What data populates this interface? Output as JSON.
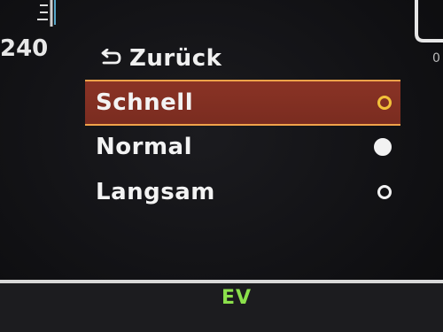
{
  "gauge": {
    "left_value": "240",
    "right_value": "0"
  },
  "menu": {
    "back_label": "Zurück",
    "items": [
      {
        "label": "Schnell",
        "selected": true,
        "radio": "highlighted-outline"
      },
      {
        "label": "Normal",
        "selected": false,
        "radio": "filled"
      },
      {
        "label": "Langsam",
        "selected": false,
        "radio": "outline"
      }
    ]
  },
  "footer": {
    "mode": "EV"
  },
  "colors": {
    "highlight_bg": "#8a3325",
    "highlight_border": "#f0a24a",
    "mode_text": "#8be04b"
  }
}
